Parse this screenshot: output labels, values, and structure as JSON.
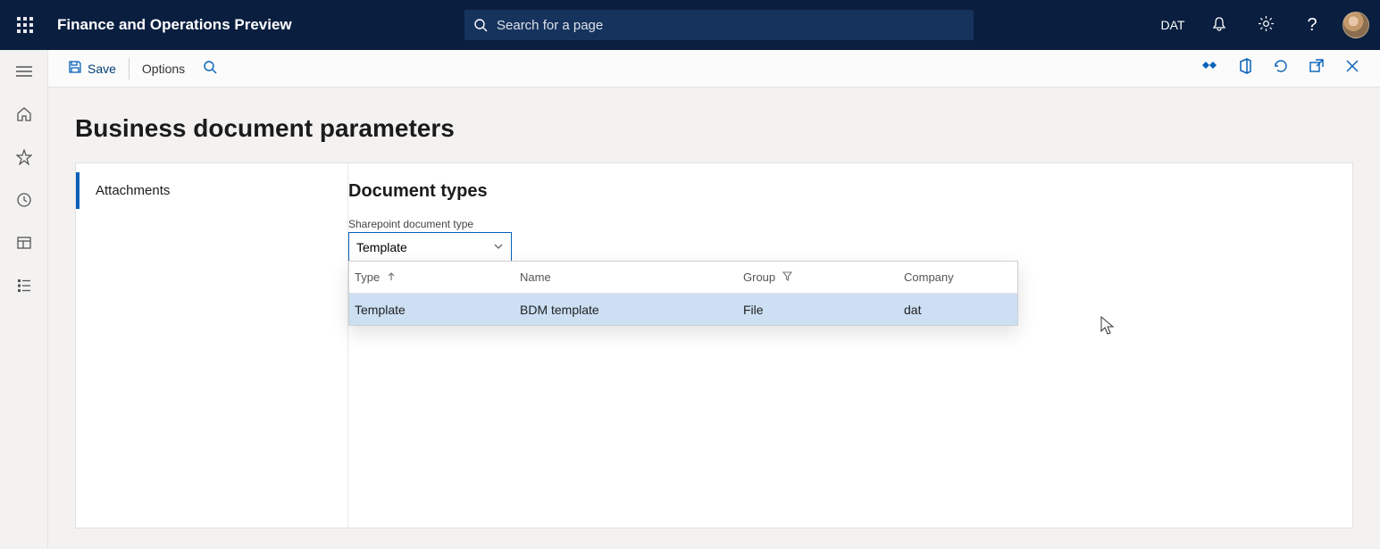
{
  "topbar": {
    "app_title": "Finance and Operations Preview",
    "search_placeholder": "Search for a page",
    "company": "DAT"
  },
  "actionbar": {
    "save_label": "Save",
    "options_label": "Options"
  },
  "page": {
    "title": "Business document parameters",
    "tab_attachments": "Attachments",
    "section_title": "Document types",
    "field_label": "Sharepoint document type",
    "dropdown_value": "Template"
  },
  "table": {
    "headers": {
      "type": "Type",
      "name": "Name",
      "group": "Group",
      "company": "Company"
    },
    "rows": [
      {
        "type": "Template",
        "name": "BDM template",
        "group": "File",
        "company": "dat"
      }
    ]
  }
}
